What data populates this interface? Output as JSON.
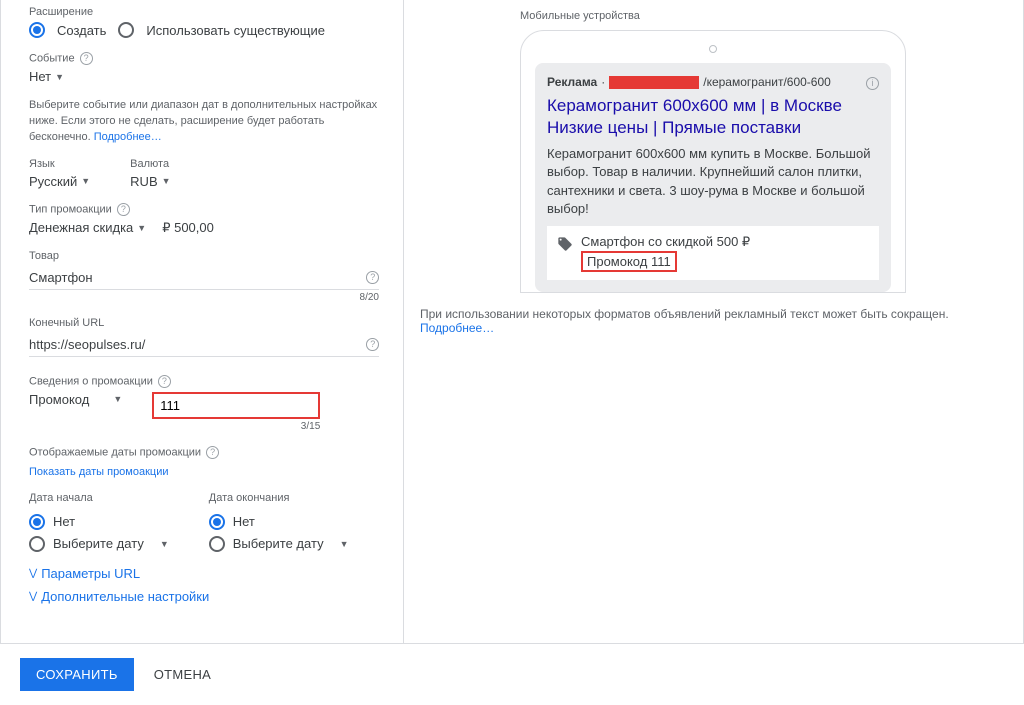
{
  "left": {
    "extension_label": "Расширение",
    "create_label": "Создать",
    "use_existing_label": "Использовать существующие",
    "event_label": "Событие",
    "event_value": "Нет",
    "event_hint": "Выберите событие или диапазон дат в дополнительных настройках ниже. Если этого не сделать, расширение будет работать бесконечно.",
    "learn_more": "Подробнее…",
    "language_label": "Язык",
    "language_value": "Русский",
    "currency_label": "Валюта",
    "currency_value": "RUB",
    "promo_type_label": "Тип промоакции",
    "promo_type_value": "Денежная скидка",
    "promo_amount": "₽ 500,00",
    "product_label": "Товар",
    "product_value": "Смартфон",
    "product_counter": "8/20",
    "final_url_label": "Конечный URL",
    "final_url_value": "https://seopulses.ru/",
    "promo_details_label": "Сведения о промоакции",
    "promo_details_type": "Промокод",
    "promo_code": "111",
    "promo_code_counter": "3/15",
    "display_dates_label": "Отображаемые даты промоакции",
    "show_dates_link": "Показать даты промоакции",
    "start_date_label": "Дата начала",
    "end_date_label": "Дата окончания",
    "date_none": "Нет",
    "date_select": "Выберите дату",
    "url_params_link": "Параметры URL",
    "advanced_link": "Дополнительные настройки"
  },
  "right": {
    "preview_title": "Мобильные устройства",
    "ad_label": "Реклама",
    "ad_path": "/керамогранит/600-600",
    "ad_title1": "Керамогранит 600х600 мм | в Москве",
    "ad_title2": "Низкие цены | Прямые поставки",
    "ad_desc": "Керамогранит 600х600 мм купить в Москве. Большой выбор. Товар в наличии. Крупнейший салон плитки, сантехники и света. 3 шоу-рума в Москве и большой выбор!",
    "promo_line1": "Смартфон со скидкой 500 ₽",
    "promo_line2": "Промокод 111",
    "disclaimer": "При использовании некоторых форматов объявлений рекламный текст может быть сокращен.",
    "disclaimer_link": "Подробнее…"
  },
  "footer": {
    "save": "СОХРАНИТЬ",
    "cancel": "ОТМЕНА"
  }
}
